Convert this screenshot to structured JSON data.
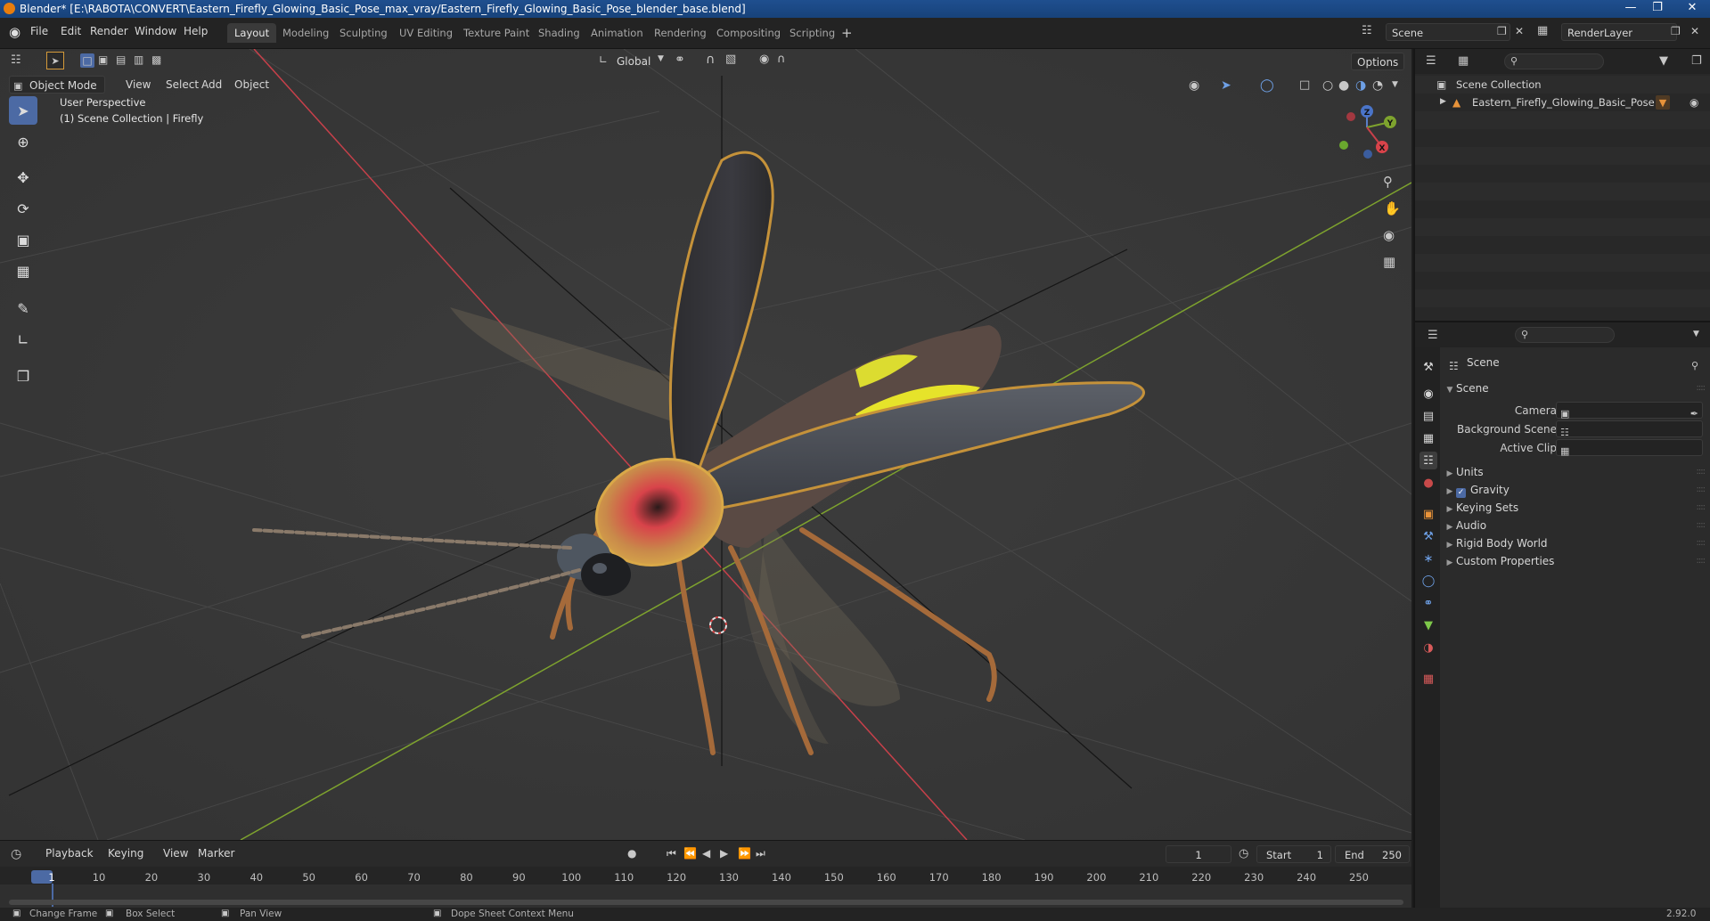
{
  "window": {
    "title": "Blender* [E:\\RABOTA\\CONVERT\\Eastern_Firefly_Glowing_Basic_Pose_max_vray/Eastern_Firefly_Glowing_Basic_Pose_blender_base.blend]"
  },
  "menu": [
    "File",
    "Edit",
    "Render",
    "Window",
    "Help"
  ],
  "workspaces": [
    "Layout",
    "Modeling",
    "Sculpting",
    "UV Editing",
    "Texture Paint",
    "Shading",
    "Animation",
    "Rendering",
    "Compositing",
    "Scripting"
  ],
  "active_workspace": "Layout",
  "scene_field": "Scene",
  "renderlayer_field": "RenderLayer",
  "viewport": {
    "transform_orientation": "Global",
    "options_label": "Options",
    "mode": "Object Mode",
    "header_menu": [
      "View",
      "Select",
      "Add",
      "Object"
    ],
    "overlay_title": "User Perspective",
    "overlay_subtitle": "(1) Scene Collection | Firefly",
    "gizmo": {
      "x": "X",
      "y": "Y",
      "z": "Z"
    }
  },
  "outliner": {
    "root": "Scene Collection",
    "items": [
      {
        "label": "Eastern_Firefly_Glowing_Basic_Pose"
      }
    ]
  },
  "properties": {
    "context": "Scene",
    "section": "Scene",
    "fields": [
      {
        "label": "Camera"
      },
      {
        "label": "Background Scene"
      },
      {
        "label": "Active Clip"
      }
    ],
    "panels": [
      {
        "label": "Units",
        "checkbox": false
      },
      {
        "label": "Gravity",
        "checkbox": true
      },
      {
        "label": "Keying Sets",
        "checkbox": false
      },
      {
        "label": "Audio",
        "checkbox": false
      },
      {
        "label": "Rigid Body World",
        "checkbox": false
      },
      {
        "label": "Custom Properties",
        "checkbox": false
      }
    ]
  },
  "timeline": {
    "menus": [
      "Playback",
      "Keying",
      "View",
      "Marker"
    ],
    "current_frame": "1",
    "start_label": "Start",
    "start": "1",
    "end_label": "End",
    "end": "250",
    "frame_labels": [
      "1",
      "10",
      "20",
      "30",
      "40",
      "50",
      "60",
      "70",
      "80",
      "90",
      "100",
      "110",
      "120",
      "130",
      "140",
      "150",
      "160",
      "170",
      "180",
      "190",
      "200",
      "210",
      "220",
      "230",
      "240",
      "250"
    ]
  },
  "statusbar": {
    "items": [
      "Change Frame",
      "Box Select",
      "Pan View",
      "Dope Sheet Context Menu"
    ],
    "version": "2.92.0"
  },
  "colors": {
    "accent": "#4c6aa4",
    "x_axis": "#c7404a",
    "y_axis": "#7ea32e",
    "viewport_bg": "#393939"
  }
}
